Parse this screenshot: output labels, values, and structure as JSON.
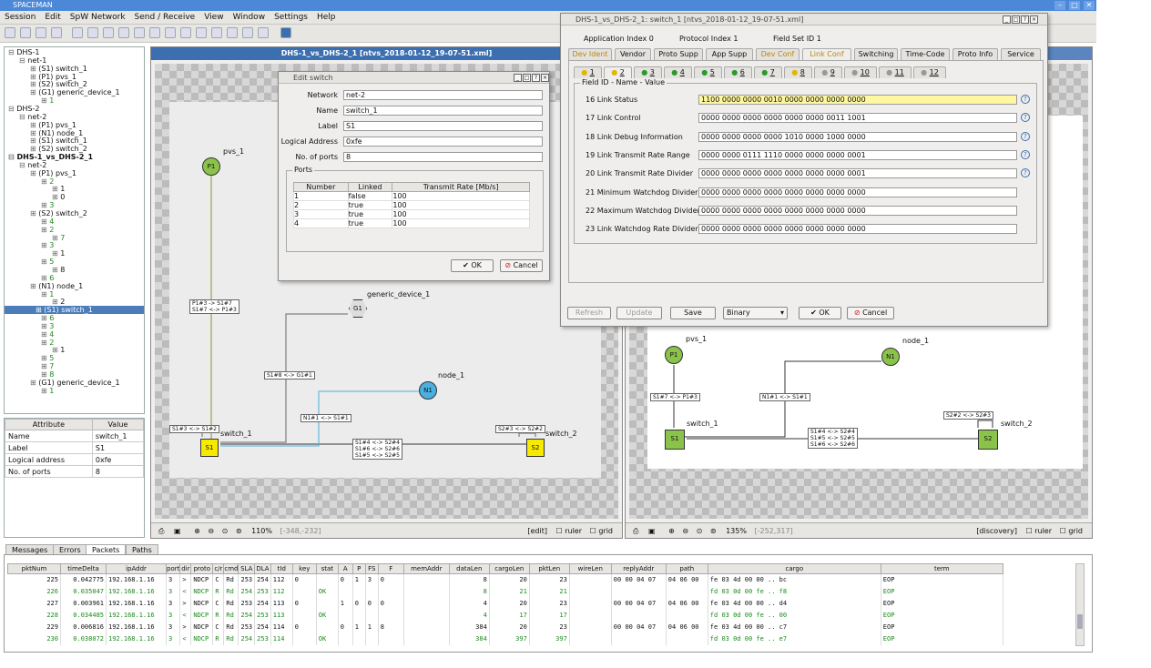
{
  "app": {
    "title": "SPACEMAN"
  },
  "menu": [
    "Session",
    "Edit",
    "SpW Network",
    "Send / Receive",
    "View",
    "Window",
    "Settings",
    "Help"
  ],
  "tree": [
    {
      "t": "DHS-1",
      "l": 0
    },
    {
      "t": "net-1",
      "l": 1
    },
    {
      "t": "(S1) switch_1",
      "l": 2
    },
    {
      "t": "(P1) pvs_1",
      "l": 2
    },
    {
      "t": "(S2) switch_2",
      "l": 2
    },
    {
      "t": "(G1) generic_device_1",
      "l": 2
    },
    {
      "t": "1",
      "l": 3,
      "c": "g"
    },
    {
      "t": "DHS-2",
      "l": 0
    },
    {
      "t": "net-2",
      "l": 1
    },
    {
      "t": "(P1) pvs_1",
      "l": 2
    },
    {
      "t": "(N1) node_1",
      "l": 2
    },
    {
      "t": "(S1) switch_1",
      "l": 2
    },
    {
      "t": "(S2) switch_2",
      "l": 2
    },
    {
      "t": "DHS-1_vs_DHS-2_1",
      "l": 0,
      "b": true
    },
    {
      "t": "net-2",
      "l": 1
    },
    {
      "t": "(P1) pvs_1",
      "l": 2
    },
    {
      "t": "2",
      "l": 3,
      "c": "g"
    },
    {
      "t": "1",
      "l": 4
    },
    {
      "t": "0",
      "l": 4
    },
    {
      "t": "3",
      "l": 3,
      "c": "g"
    },
    {
      "t": "(S2) switch_2",
      "l": 2
    },
    {
      "t": "4",
      "l": 3,
      "c": "g"
    },
    {
      "t": "2",
      "l": 3,
      "c": "g"
    },
    {
      "t": "7",
      "l": 4,
      "c": "g"
    },
    {
      "t": "3",
      "l": 3,
      "c": "g"
    },
    {
      "t": "1",
      "l": 4
    },
    {
      "t": "5",
      "l": 3,
      "c": "g"
    },
    {
      "t": "8",
      "l": 4
    },
    {
      "t": "6",
      "l": 3,
      "c": "g"
    },
    {
      "t": "(N1) node_1",
      "l": 2
    },
    {
      "t": "1",
      "l": 3,
      "c": "g"
    },
    {
      "t": "2",
      "l": 4
    },
    {
      "t": "(S1) switch_1",
      "l": 2,
      "sel": true
    },
    {
      "t": "6",
      "l": 3,
      "c": "g"
    },
    {
      "t": "3",
      "l": 3,
      "c": "g"
    },
    {
      "t": "4",
      "l": 3,
      "c": "g"
    },
    {
      "t": "2",
      "l": 3,
      "c": "g"
    },
    {
      "t": "1",
      "l": 4
    },
    {
      "t": "5",
      "l": 3,
      "c": "g"
    },
    {
      "t": "7",
      "l": 3,
      "c": "g"
    },
    {
      "t": "8",
      "l": 3,
      "c": "g"
    },
    {
      "t": "(G1) generic_device_1",
      "l": 2
    },
    {
      "t": "1",
      "l": 3,
      "c": "g"
    }
  ],
  "attrs": {
    "head": [
      "Attribute",
      "Value"
    ],
    "rows": [
      [
        "Name",
        "switch_1"
      ],
      [
        "Label",
        "S1"
      ],
      [
        "Logical address",
        "0xfe"
      ],
      [
        "No. of ports",
        "8"
      ]
    ]
  },
  "left_win": {
    "title": "DHS-1_vs_DHS-2_1 [ntvs_2018-01-12_19-07-51.xml]",
    "zoom": "110%",
    "coords": "[-348,-232]",
    "mode": "[edit]",
    "ruler": "ruler",
    "grid": "grid"
  },
  "right_win": {
    "zoom": "135%",
    "coords": "[-252,317]",
    "mode": "[discovery]",
    "ruler": "ruler",
    "grid": "grid"
  },
  "edit_switch": {
    "title": "Edit switch",
    "network_label": "Network",
    "network": "net-2",
    "name_label": "Name",
    "name": "switch_1",
    "label_label": "Label",
    "label": "S1",
    "la_label": "Logical Address",
    "la": "0xfe",
    "np_label": "No. of ports",
    "np": "8",
    "ports_label": "Ports",
    "cols": [
      "Number",
      "Linked",
      "Transmit Rate [Mb/s]"
    ],
    "rows": [
      [
        "1",
        "false",
        "100"
      ],
      [
        "2",
        "true",
        "100"
      ],
      [
        "3",
        "true",
        "100"
      ],
      [
        "4",
        "true",
        "100"
      ]
    ],
    "ok": "OK",
    "cancel": "Cancel"
  },
  "conf": {
    "title": "DHS-1_vs_DHS-2_1: switch_1 [ntvs_2018-01-12_19-07-51.xml]",
    "app_index": "Application Index  0",
    "proto_index": "Protocol Index  1",
    "field_set": "Field Set ID  1",
    "tabs": [
      "Dev Ident",
      "Vendor",
      "Proto Supp",
      "App Supp",
      "Dev Conf",
      "Link Conf",
      "Switching",
      "Time-Code",
      "Proto Info",
      "Service"
    ],
    "subtabs": [
      "1",
      "2",
      "3",
      "4",
      "5",
      "6",
      "7",
      "8",
      "9",
      "10",
      "11",
      "12"
    ],
    "group": "Field ID - Name - Value",
    "fields": [
      [
        "16  Link Status",
        "1100 0000 0000 0010 0000 0000 0000 0000"
      ],
      [
        "17  Link Control",
        "0000 0000 0000 0000 0000 0000 0011 1001"
      ],
      [
        "18  Link Debug Information",
        "0000 0000 0000 0000 1010 0000 1000 0000"
      ],
      [
        "19  Link Transmit Rate Range",
        "0000 0000 0111 1110 0000 0000 0000 0001"
      ],
      [
        "20  Link Transmit Rate Divider",
        "0000 0000 0000 0000 0000 0000 0000 0001"
      ],
      [
        "21  Minimum Watchdog Divider",
        "0000 0000 0000 0000 0000 0000 0000 0000"
      ],
      [
        "22  Maximum Watchdog Divider",
        "0000 0000 0000 0000 0000 0000 0000 0000"
      ],
      [
        "23  Link Watchdog Rate Divider",
        "0000 0000 0000 0000 0000 0000 0000 0000"
      ]
    ],
    "refresh": "Refresh",
    "update": "Update",
    "save": "Save",
    "format": "Binary",
    "ok": "OK",
    "cancel": "Cancel"
  },
  "diagram_left": {
    "pvs": "pvs_1",
    "p1": "P1",
    "g1": "G1",
    "generic": "generic_device_1",
    "n1": "N1",
    "node": "node_1",
    "s1": "S1",
    "switch1": "switch_1",
    "s2": "S2",
    "switch2": "switch_2",
    "l_p1s1": "P1#3 -> S1#7\nS1#7 <-> P1#3",
    "l_s1g1": "S1#8 <-> G1#1",
    "l_n1s1": "N1#1 <-> S1#1",
    "l_s1s2": "S1#4 <-> S2#4\nS1#6 <-> S2#6\nS1#5 <-> S2#5",
    "l_s1l": "S1#3 <-> S1#2",
    "l_s2": "S2#3 <-> S2#2"
  },
  "diagram_right": {
    "pvs": "pvs_1",
    "p1": "P1",
    "n1": "N1",
    "node": "node_1",
    "s1": "S1",
    "switch1": "switch_1",
    "s2": "S2",
    "switch2": "switch_2",
    "l_s1p1": "S1#7 <-> P1#3",
    "l_n1s1": "N1#1 <-> S1#1",
    "l_s1s2": "S1#4 <-> S2#4\nS1#5 <-> S2#5\nS1#6 <-> S2#6",
    "l_s2": "S2#2 <-> S2#3"
  },
  "bottom_tabs": [
    "Messages",
    "Errors",
    "Packets",
    "Paths"
  ],
  "packets": {
    "cols": [
      "pktNum",
      "timeDelta",
      "ipAddr",
      "port",
      "dir",
      "proto",
      "c/r",
      "cmd",
      "SLA",
      "DLA",
      "tId",
      "key",
      "stat",
      "A",
      "P",
      "FS",
      "F",
      "memAddr",
      "dataLen",
      "cargoLen",
      "pktLen",
      "wireLen",
      "replyAddr",
      "path",
      "cargo",
      "term"
    ],
    "rows": [
      [
        "225",
        "0.042775",
        "192.168.1.16",
        "3",
        ">",
        "NDCP",
        "C",
        "Rd",
        "253",
        "254",
        "112",
        "0",
        "",
        "0",
        "1",
        "3",
        "0",
        "",
        "8",
        "20",
        "23",
        "",
        "00 00 04 07",
        "04 06 00",
        "fe 03 4d 00    00 .. bc",
        "EOP"
      ],
      [
        "226",
        "0.035047",
        "192.168.1.16",
        "3",
        "<",
        "NDCP",
        "R",
        "Rd",
        "254",
        "253",
        "112",
        "",
        "OK",
        "",
        "",
        "",
        "",
        "",
        "8",
        "21",
        "21",
        "",
        "",
        "",
        "fd 03 0d 00    fe .. f8",
        "EOP"
      ],
      [
        "227",
        "0.003961",
        "192.168.1.16",
        "3",
        ">",
        "NDCP",
        "C",
        "Rd",
        "253",
        "254",
        "113",
        "0",
        "",
        "1",
        "0",
        "0",
        "0",
        "",
        "4",
        "20",
        "23",
        "",
        "00 00 04 07",
        "04 06 00",
        "fe 03 4d 00    00 .. d4",
        "EOP"
      ],
      [
        "228",
        "0.034485",
        "192.168.1.16",
        "3",
        "<",
        "NDCP",
        "R",
        "Rd",
        "254",
        "253",
        "113",
        "",
        "OK",
        "",
        "",
        "",
        "",
        "",
        "4",
        "17",
        "17",
        "",
        "",
        "",
        "fd 03 0d 00    fe .. 00",
        "EOP"
      ],
      [
        "229",
        "0.006816",
        "192.168.1.16",
        "3",
        ">",
        "NDCP",
        "C",
        "Rd",
        "253",
        "254",
        "114",
        "0",
        "",
        "0",
        "1",
        "1",
        "8",
        "",
        "384",
        "20",
        "23",
        "",
        "00 00 04 07",
        "04 06 00",
        "fe 03 4d 00    00 .. c7",
        "EOP"
      ],
      [
        "230",
        "0.038072",
        "192.168.1.16",
        "3",
        "<",
        "NDCP",
        "R",
        "Rd",
        "254",
        "253",
        "114",
        "",
        "OK",
        "",
        "",
        "",
        "",
        "",
        "384",
        "397",
        "397",
        "",
        "",
        "",
        "fd 03 0d 00    fe .. e7",
        "EOP"
      ]
    ]
  },
  "colors": {
    "accent": "#3c6fb0",
    "node_green": "#8bc34a",
    "switch_yellow": "#f5ea00",
    "switch_green": "#8bc34a",
    "ok_green": "#1a8a1a"
  }
}
